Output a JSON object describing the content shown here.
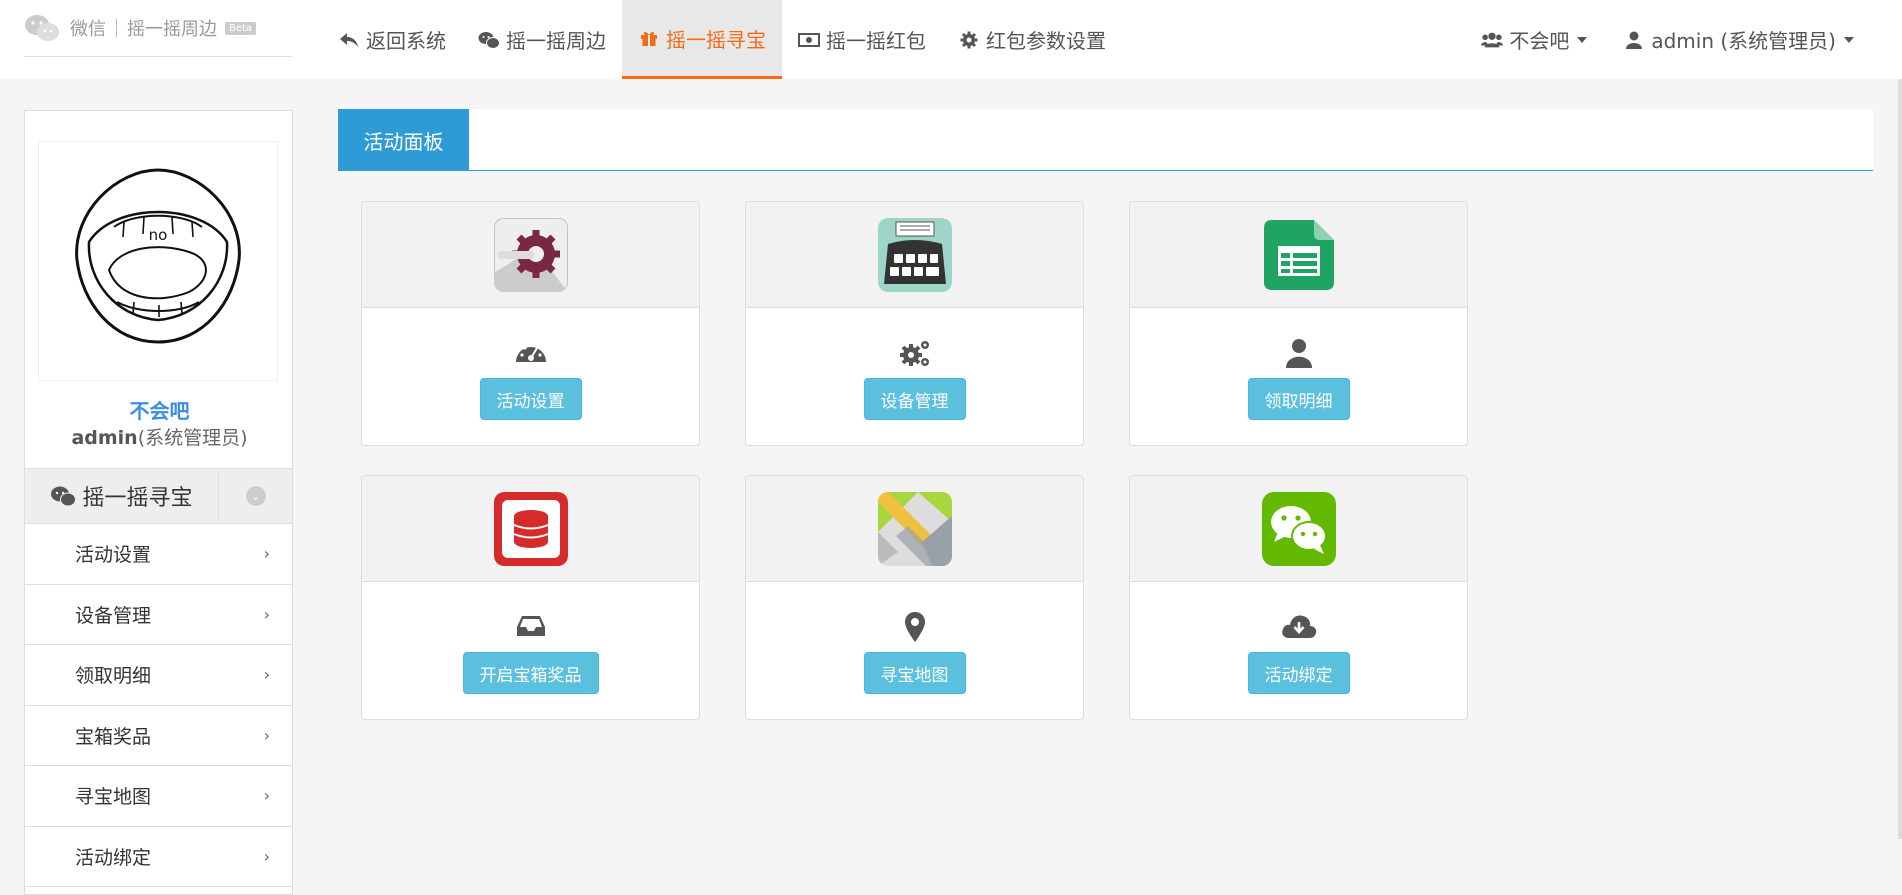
{
  "brand": {
    "name": "微信",
    "product": "摇一摇周边",
    "badge": "Beta"
  },
  "nav": [
    {
      "label": "返回系统",
      "icon": "reply-icon"
    },
    {
      "label": "摇一摇周边",
      "icon": "wechat-icon"
    },
    {
      "label": "摇一摇寻宝",
      "icon": "gift-icon",
      "active": true
    },
    {
      "label": "摇一摇红包",
      "icon": "money-icon"
    },
    {
      "label": "红包参数设置",
      "icon": "gear-icon"
    }
  ],
  "nav_right": {
    "group": "不会吧",
    "user": "admin (系统管理员)"
  },
  "sidebar": {
    "user_name": "不会吧",
    "user_login": "admin",
    "user_role": "(系统管理员)",
    "avatar_text": "no",
    "menu_title": "摇一摇寻宝",
    "items": [
      "活动设置",
      "设备管理",
      "领取明细",
      "宝箱奖品",
      "寻宝地图",
      "活动绑定"
    ]
  },
  "panel": {
    "tab": "活动面板",
    "cards": [
      {
        "button": "活动设置",
        "app_icon": "settings-app-icon",
        "glyph": "dashboard-icon"
      },
      {
        "button": "设备管理",
        "app_icon": "typewriter-app-icon",
        "glyph": "cogs-icon"
      },
      {
        "button": "领取明细",
        "app_icon": "spreadsheet-app-icon",
        "glyph": "user-icon"
      },
      {
        "button": "开启宝箱奖品",
        "app_icon": "database-app-icon",
        "glyph": "inbox-icon"
      },
      {
        "button": "寻宝地图",
        "app_icon": "maps-app-icon",
        "glyph": "map-marker-icon"
      },
      {
        "button": "活动绑定",
        "app_icon": "wechat-app-icon",
        "glyph": "cloud-download-icon"
      }
    ]
  },
  "colors": {
    "accent": "#f56a14",
    "primary": "#2f9bd6",
    "info_button": "#5bc0de",
    "wechat_green": "#62b900"
  }
}
